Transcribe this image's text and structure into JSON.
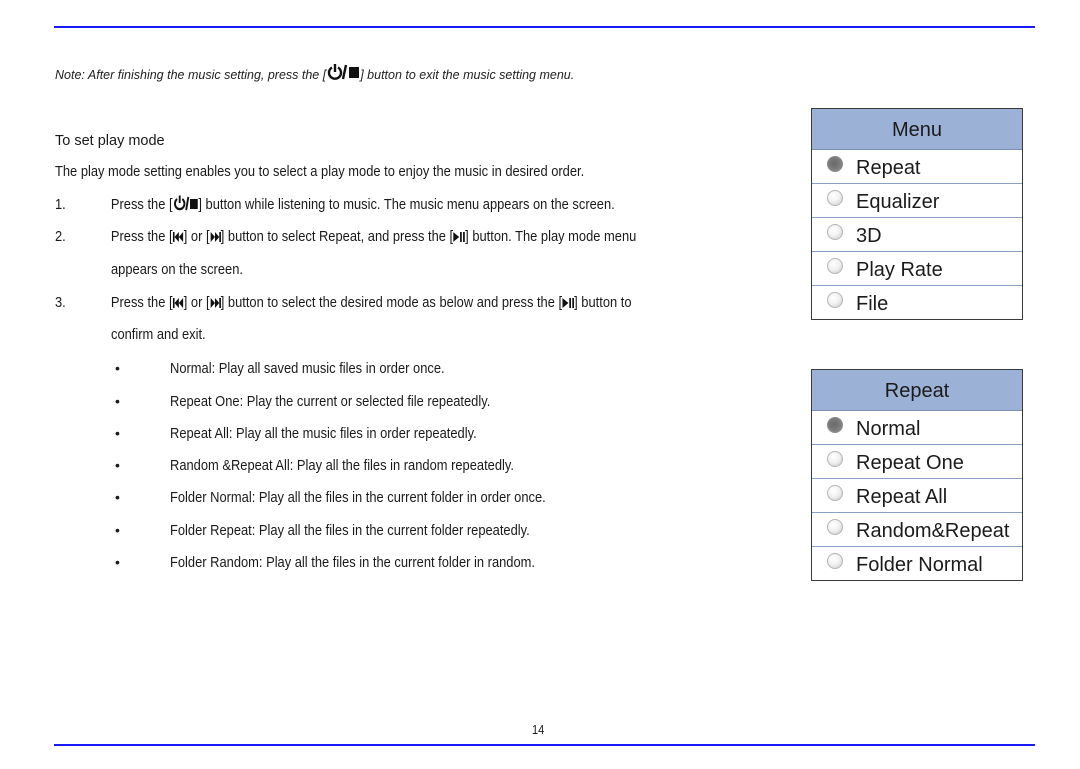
{
  "note": {
    "label": "Note:",
    "before": " After finishing the music setting, press the [",
    "after": "] button to exit the music setting menu."
  },
  "section": {
    "heading": "To set play mode",
    "intro": "The play mode setting enables you to select a play mode to enjoy the music in desired order."
  },
  "steps": [
    {
      "num": "1.",
      "parts": [
        "Press the [",
        "] button while listening to music. The music menu appears on the screen."
      ]
    },
    {
      "num": "2.",
      "parts": [
        "Press the [",
        "] or [",
        "] button to select ",
        "Repeat",
        ", and press the [",
        "] button. The play mode menu"
      ],
      "continuation": "appears on the screen."
    },
    {
      "num": "3.",
      "parts": [
        "Press the [",
        "] or [",
        "] button to select the desired mode as below and press the [",
        "] button to"
      ],
      "continuation": "confirm and exit."
    }
  ],
  "modes": [
    {
      "name": "Normal",
      "desc": ": Play all saved music files in order once."
    },
    {
      "name": "Repeat One",
      "desc": ": Play the current or selected file repeatedly."
    },
    {
      "name": "Repeat All",
      "desc": ": Play all the music files in order repeatedly."
    },
    {
      "name": "Random &Repeat All",
      "desc": ": Play all the files in random repeatedly."
    },
    {
      "name": "Folder Normal",
      "desc": ": Play all the files in the current folder in order once."
    },
    {
      "name": "Folder Repeat",
      "desc": ": Play all the files in the current folder repeatedly."
    },
    {
      "name": "Folder Random",
      "desc": ": Play all the files in the current folder in random."
    }
  ],
  "bullet_char": "•",
  "menu": {
    "title": "Menu",
    "items": [
      {
        "label": "Repeat",
        "selected": true
      },
      {
        "label": "Equalizer",
        "selected": false
      },
      {
        "label": "3D",
        "selected": false
      },
      {
        "label": "Play Rate",
        "selected": false
      },
      {
        "label": "File",
        "selected": false
      }
    ]
  },
  "repeat_menu": {
    "title": "Repeat",
    "items": [
      {
        "label": "Normal",
        "selected": true
      },
      {
        "label": "Repeat One",
        "selected": false
      },
      {
        "label": "Repeat All",
        "selected": false
      },
      {
        "label": "Random&Repeat",
        "selected": false
      },
      {
        "label": "Folder Normal",
        "selected": false
      }
    ]
  },
  "icons": {
    "power_stop": "power-stop-icon",
    "prev": "previous-track-icon",
    "next": "next-track-icon",
    "play_pause": "play-pause-icon"
  },
  "colors": {
    "rule": "#1a1aff",
    "menu_header": "#9cb1d6",
    "menu_divider": "#8aa0c4"
  },
  "page_number": "14"
}
